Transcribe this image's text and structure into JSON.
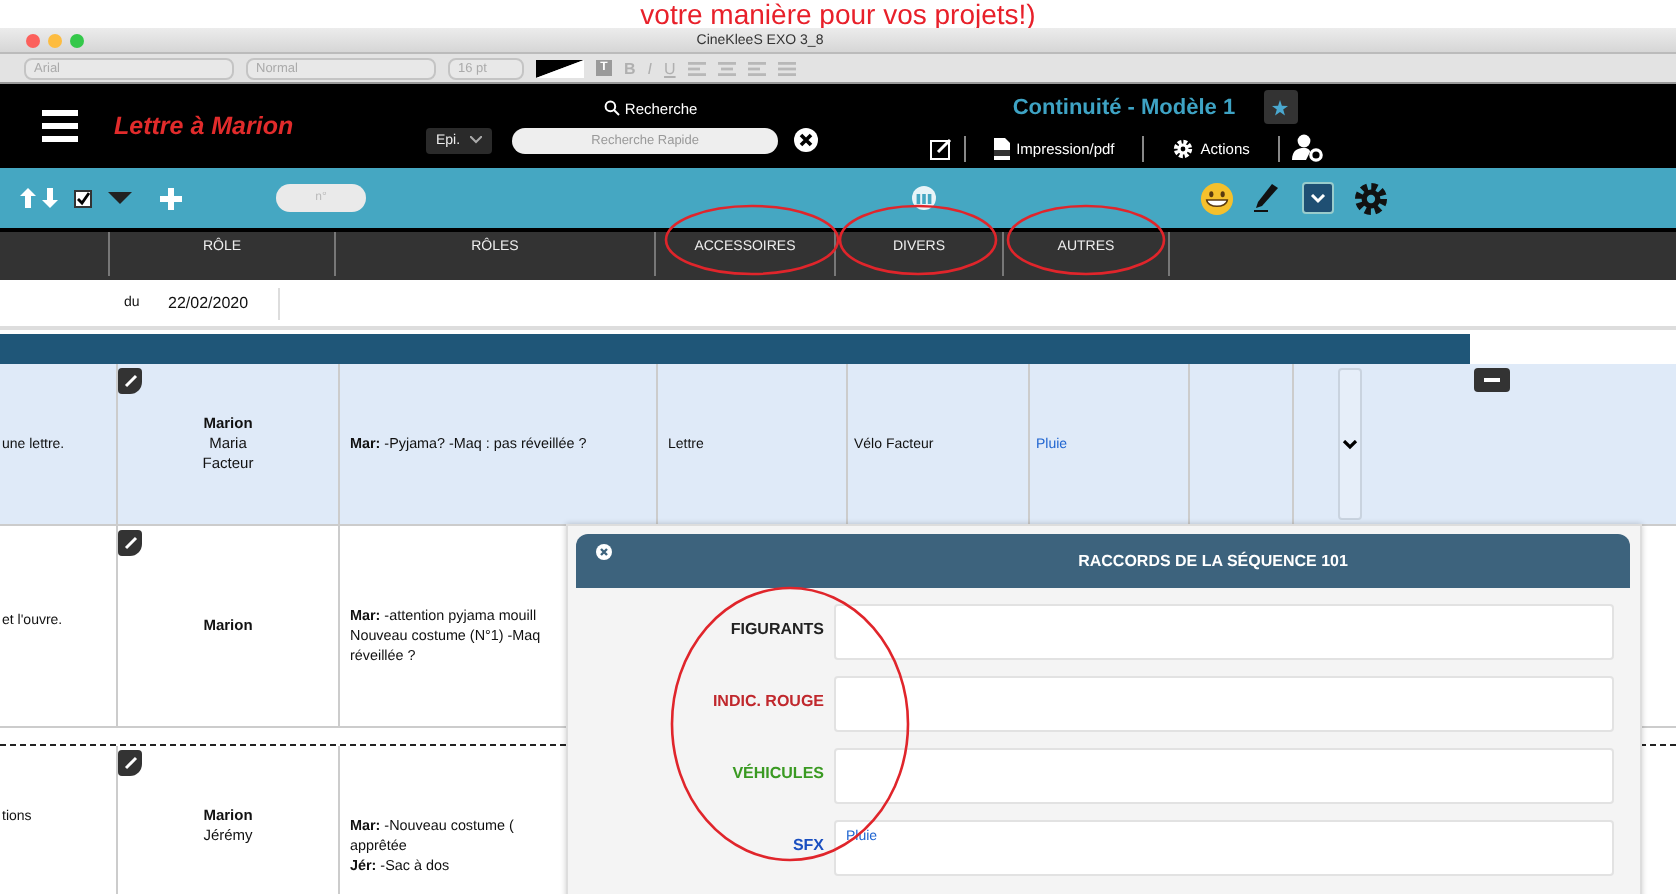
{
  "annotation": {
    "text": "votre manière pour vos projets!)"
  },
  "window": {
    "title": "CineKleeS EXO 3_8"
  },
  "format_toolbar": {
    "font": "Arial",
    "style": "Normal",
    "size": "16 pt",
    "text_button": "T",
    "styles": [
      {
        "label": "B",
        "kind": "bold"
      },
      {
        "label": "I",
        "kind": "italic"
      },
      {
        "label": "U",
        "kind": "underline"
      }
    ]
  },
  "header": {
    "document_title": "Lettre à Marion",
    "episode": "Epi.",
    "search_label": "Recherche",
    "search_placeholder": "Recherche Rapide",
    "model_title": "Continuité - Modèle 1",
    "actions": [
      {
        "label": "Impression/pdf",
        "kind": "pdf"
      },
      {
        "label": "Actions",
        "kind": "gear"
      }
    ]
  },
  "toolbar": {
    "number_placeholder": "n°",
    "select_checked": true
  },
  "table": {
    "columns": [
      "RÔLE",
      "RÔLES",
      "ACCESSOIRES",
      "DIVERS",
      "AUTRES"
    ],
    "date_row": {
      "prefix": "du",
      "date": "22/02/2020"
    },
    "rows": [
      {
        "highlighted": true,
        "dashed_top": false,
        "description": "une lettre.",
        "characters": [
          "Marion",
          "Maria",
          "Facteur"
        ],
        "dialogue": [
          "**Mar:** -Pyjama? -Maq : pas réveillée ?"
        ],
        "accessoires": "Lettre",
        "divers": "Vélo Facteur",
        "autres": "Pluie"
      },
      {
        "highlighted": false,
        "dashed_top": false,
        "description": "et l'ouvre.",
        "characters": [
          "Marion"
        ],
        "dialogue": [
          "**Mar:** -attention pyjama mouill",
          "Nouveau costume (N°1) -Maq",
          "réveillée ?"
        ]
      },
      {
        "highlighted": false,
        "dashed_top": true,
        "description": "tions",
        "characters": [
          "Marion",
          "Jérémy"
        ],
        "dialogue": [
          "**Mar:** -Nouveau costume (",
          "apprêtée",
          "**Jér:** -Sac à dos"
        ]
      }
    ]
  },
  "popup": {
    "title": "RACCORDS DE LA SÉQUENCE 101",
    "fields": [
      {
        "label": "FIGURANTS",
        "color": "#222222"
      },
      {
        "label": "INDIC. ROUGE",
        "color": "#c0282d"
      },
      {
        "label": "VÉHICULES",
        "color": "#3a9a22"
      },
      {
        "label": "SFX",
        "color": "#1a4fc0",
        "value": "Pluie"
      }
    ]
  }
}
